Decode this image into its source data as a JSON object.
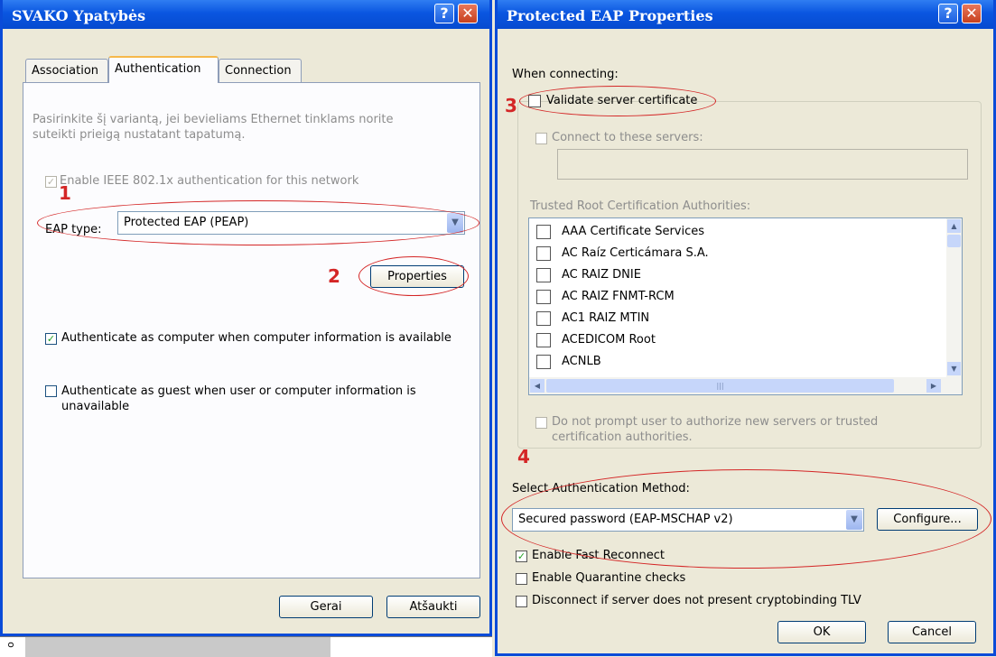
{
  "left_window": {
    "title": "SVAKO Ypatybės",
    "tabs": [
      "Association",
      "Authentication",
      "Connection"
    ],
    "description": "Pasirinkite šį variantą, jei bevieliams Ethernet tinklams norite suteikti prieigą nustatant tapatumą.",
    "enable_8021x_label": "Enable IEEE 802.1x authentication for this network",
    "eap_type_label": "EAP type:",
    "eap_type_value": "Protected EAP (PEAP)",
    "properties_label": "Properties",
    "auth_computer_label": "Authenticate as computer when computer information is available",
    "auth_guest_label": "Authenticate as guest when user or computer information is unavailable",
    "ok_label": "Gerai",
    "cancel_label": "Atšaukti",
    "annotations": [
      "1",
      "2"
    ],
    "bottom_fragment": "o"
  },
  "right_window": {
    "title": "Protected EAP Properties",
    "when_connecting": "When connecting:",
    "validate_cert_label": "Validate server certificate",
    "connect_servers_label": "Connect to these servers:",
    "trusted_root_label": "Trusted Root Certification Authorities:",
    "ca_list": [
      "AAA Certificate Services",
      "AC Raíz Certicámara S.A.",
      "AC RAIZ DNIE",
      "AC RAIZ FNMT-RCM",
      "AC1 RAIZ MTIN",
      "ACEDICOM Root",
      "ACNLB"
    ],
    "scroll_middle_glyph": "|||",
    "do_not_prompt_label": "Do not prompt user to authorize new servers or trusted certification authorities.",
    "select_method_label": "Select Authentication Method:",
    "method_value": "Secured password (EAP-MSCHAP v2)",
    "configure_label": "Configure...",
    "fast_reconnect_label": "Enable Fast Reconnect",
    "quarantine_label": "Enable Quarantine checks",
    "cryptobinding_label": "Disconnect if server does not present cryptobinding TLV",
    "ok_label": "OK",
    "cancel_label": "Cancel",
    "annotations": [
      "3",
      "4"
    ]
  },
  "icons": {
    "help": "?",
    "close": "✕",
    "check": "✓",
    "combo_arrow": "▼",
    "scroll_up": "▲",
    "scroll_down": "▼",
    "scroll_left": "◀",
    "scroll_right": "▶"
  },
  "colors": {
    "titlebar": "#0a56e0",
    "annotation": "#d42626",
    "check": "#21a121"
  }
}
